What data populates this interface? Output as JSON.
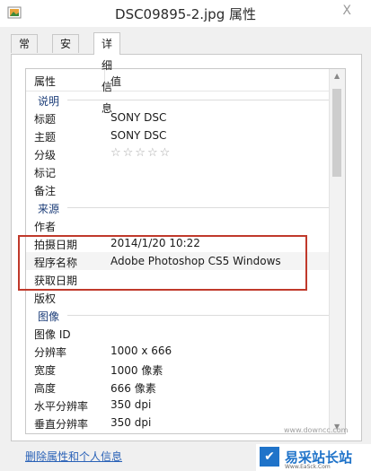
{
  "window": {
    "title": "DSC09895-2.jpg 属性",
    "close_glyph": "X"
  },
  "tabs": [
    {
      "label": "常规",
      "active": false
    },
    {
      "label": "安全",
      "active": false
    },
    {
      "label": "详细信息",
      "active": true
    }
  ],
  "table": {
    "header": {
      "property": "属性",
      "value": "值"
    },
    "sections": {
      "description": "说明",
      "origin": "来源",
      "image": "图像"
    },
    "rows": {
      "title": {
        "k": "标题",
        "v": "SONY DSC"
      },
      "subject": {
        "k": "主题",
        "v": "SONY DSC"
      },
      "rating": {
        "k": "分级",
        "stars": "☆☆☆☆☆",
        "value": 0
      },
      "tags": {
        "k": "标记",
        "v": ""
      },
      "comments": {
        "k": "备注",
        "v": ""
      },
      "author": {
        "k": "作者",
        "v": ""
      },
      "date_taken": {
        "k": "拍摄日期",
        "v": "2014/1/20 10:22"
      },
      "program": {
        "k": "程序名称",
        "v": "Adobe Photoshop CS5 Windows"
      },
      "date_acquired": {
        "k": "获取日期",
        "v": ""
      },
      "copyright": {
        "k": "版权",
        "v": ""
      },
      "image_id": {
        "k": "图像 ID",
        "v": ""
      },
      "dimensions": {
        "k": "分辨率",
        "v": "1000 x 666"
      },
      "width": {
        "k": "宽度",
        "v": "1000 像素"
      },
      "height": {
        "k": "高度",
        "v": "666 像素"
      },
      "hres": {
        "k": "水平分辨率",
        "v": "350 dpi"
      },
      "vres": {
        "k": "垂直分辨率",
        "v": "350 dpi"
      }
    }
  },
  "footer": {
    "remove_link": "删除属性和个人信息"
  },
  "watermark": {
    "url": "www.downcc.com",
    "logo_text": "易采站长站",
    "logo_glyph": "✔",
    "logo_sub": "Www.EaSck.Com"
  },
  "colors": {
    "highlight_box": "#c0392b",
    "link": "#2a62b7",
    "section": "#1e3f7a"
  }
}
